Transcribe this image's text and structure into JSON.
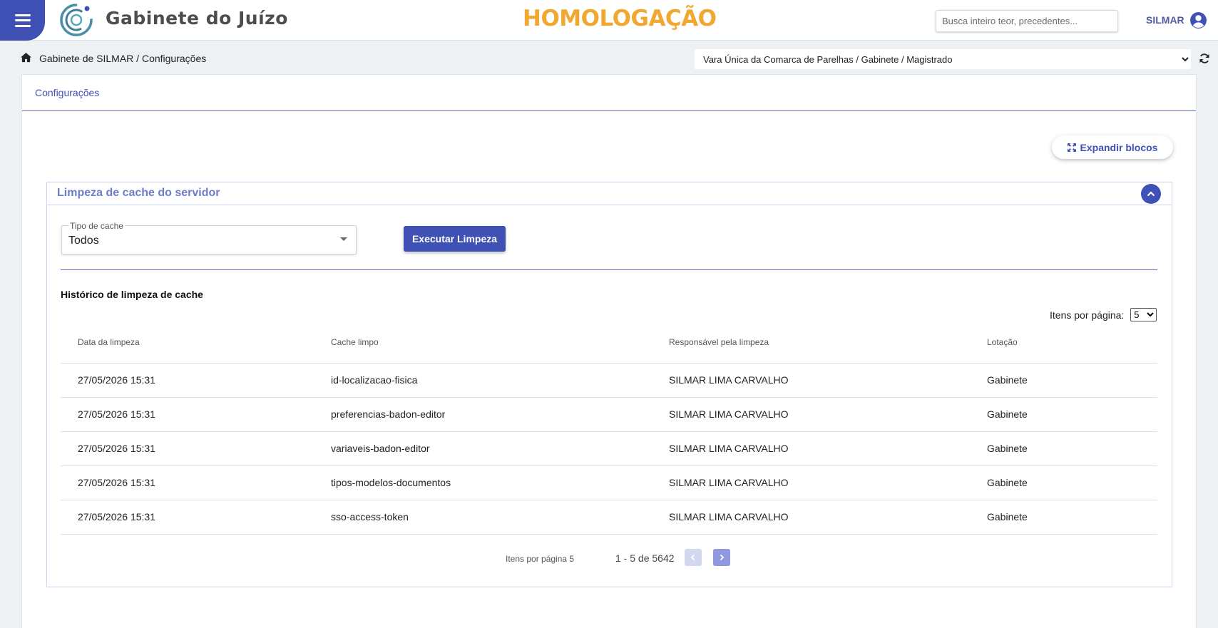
{
  "header": {
    "app_title": "Gabinete do Juízo",
    "environment": "HOMOLOGAÇÃO",
    "search_placeholder": "Busca inteiro teor, precedentes...",
    "user_name": "SILMAR",
    "accent_color": "#3f51b5",
    "environment_color": "#f0a830",
    "menu_icon": "hamburger-icon",
    "user_icon": "user-circle-icon",
    "logo_icon": "logo-icon"
  },
  "breadcrumb": {
    "icon": "home-icon",
    "text": "Gabinete de SILMAR / Configurações"
  },
  "unit_selector": {
    "selected": "Vara Única da Comarca de Parelhas / Gabinete / Magistrado",
    "refresh_icon": "refresh-icon"
  },
  "page": {
    "tab_label": "Configurações",
    "expand_button_label": "Expandir blocos",
    "expand_icon": "expand-icon"
  },
  "cache_panel": {
    "title": "Limpeza de cache do servidor",
    "collapse_icon": "chevron-up-icon",
    "cache_type_label": "Tipo de cache",
    "cache_type_value": "Todos",
    "execute_button_label": "Executar Limpeza",
    "history_title": "Histórico de limpeza de cache",
    "items_per_page_label": "Itens por página:",
    "items_per_page_value": "5",
    "columns": [
      "Data da limpeza",
      "Cache limpo",
      "Responsável pela limpeza",
      "Lotação"
    ],
    "rows": [
      [
        "27/05/2026 15:31",
        "id-localizacao-fisica",
        "SILMAR LIMA CARVALHO",
        "Gabinete"
      ],
      [
        "27/05/2026 15:31",
        "preferencias-badon-editor",
        "SILMAR LIMA CARVALHO",
        "Gabinete"
      ],
      [
        "27/05/2026 15:31",
        "variaveis-badon-editor",
        "SILMAR LIMA CARVALHO",
        "Gabinete"
      ],
      [
        "27/05/2026 15:31",
        "tipos-modelos-documentos",
        "SILMAR LIMA CARVALHO",
        "Gabinete"
      ],
      [
        "27/05/2026 15:31",
        "sso-access-token",
        "SILMAR LIMA CARVALHO",
        "Gabinete"
      ]
    ],
    "pager": {
      "label": "Itens por página 5",
      "range": "1 - 5 de 5642",
      "prev_icon": "chevron-left-icon",
      "next_icon": "chevron-right-icon"
    }
  }
}
